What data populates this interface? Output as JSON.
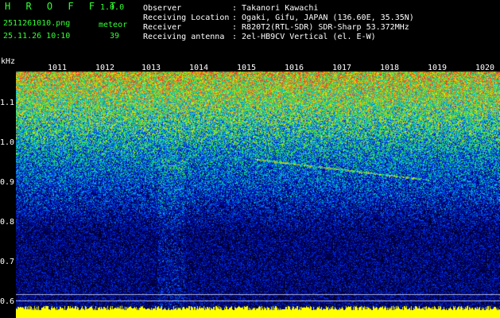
{
  "header": {
    "title": "H R O F F T",
    "version": "1.0.0",
    "filename": "2511261010.png",
    "datetime": "25.11.26 10:10",
    "category": "meteor",
    "count": "39",
    "fields": [
      {
        "label": "Observer",
        "value": ": Takanori Kawachi"
      },
      {
        "label": "Receiving Location",
        "value": ": Ogaki, Gifu, JAPAN (136.60E, 35.35N)"
      },
      {
        "label": "Receiver",
        "value": ": R820T2(RTL-SDR) SDR-Sharp 53.372MHz"
      },
      {
        "label": "Receiving antenna",
        "value": ": 2el-HB9CV Vertical (el. E-W)"
      }
    ]
  },
  "axis": {
    "y_unit": "kHz",
    "y_ticks": [
      "1.1",
      "1.0",
      "0.9",
      "0.8",
      "0.7",
      "0.6"
    ],
    "x_ticks": [
      "1011",
      "1012",
      "1013",
      "1014",
      "1015",
      "1016",
      "1017",
      "1018",
      "1019",
      "1020"
    ]
  },
  "colors": {
    "text_green": "#33ff33",
    "text_white": "#ffffff",
    "background": "#000000",
    "signal_bar": "#ffff00"
  }
}
